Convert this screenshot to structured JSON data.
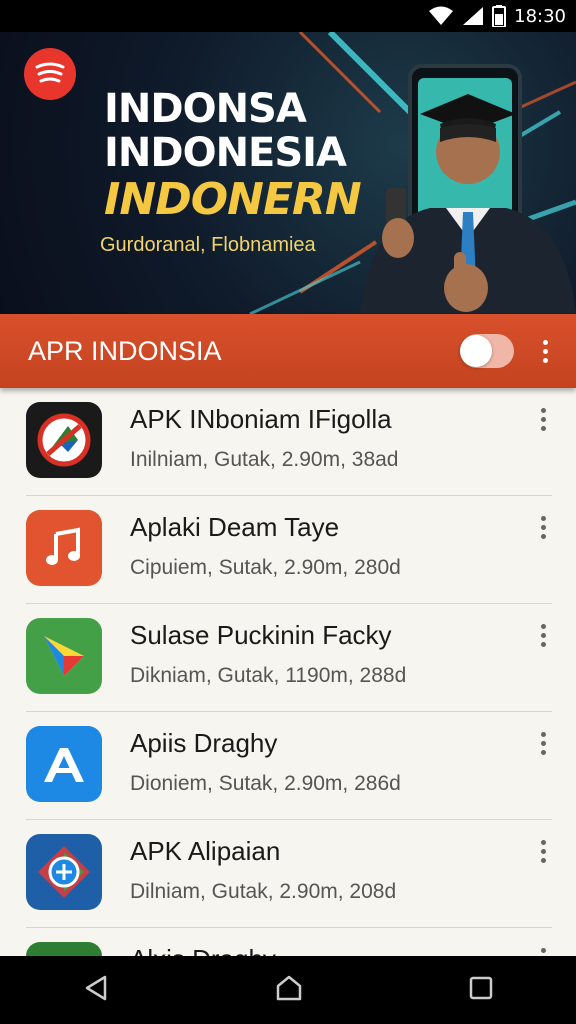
{
  "status": {
    "time": "18:30"
  },
  "banner": {
    "title_line1": "INDONSA",
    "title_line2": "INDONESIA",
    "title_line3": "INDONERN",
    "subtitle": "Gurdoranal, Flobnamiea",
    "accent_color": "#f5c842"
  },
  "toolbar": {
    "title": "APR INDONSIA",
    "toggle_on": true,
    "color": "#c9471f"
  },
  "apps": [
    {
      "title": "APK INboniam IFigolla",
      "meta": "Inilniam, Gutak, 2.90m, 38ad",
      "icon": "red-circle-slash-icon"
    },
    {
      "title": "Aplaki Deam Taye",
      "meta": "Cipuiem, Sutak, 2.90m, 280d",
      "icon": "music-note-icon"
    },
    {
      "title": "Sulase Puckinin Facky",
      "meta": "Dikniam, Gutak, 1190m, 288d",
      "icon": "green-play-triangle-icon"
    },
    {
      "title": "Apiis Draghy",
      "meta": "Dioniem, Sutak, 2.90m, 286d",
      "icon": "blue-a-letter-icon"
    },
    {
      "title": "APK Alipaian",
      "meta": "Dilniam, Gutak, 2.90m, 208d",
      "icon": "plus-globe-icon"
    },
    {
      "title": "Alxis Draghy",
      "meta": "",
      "icon": "partial-app-icon"
    }
  ]
}
